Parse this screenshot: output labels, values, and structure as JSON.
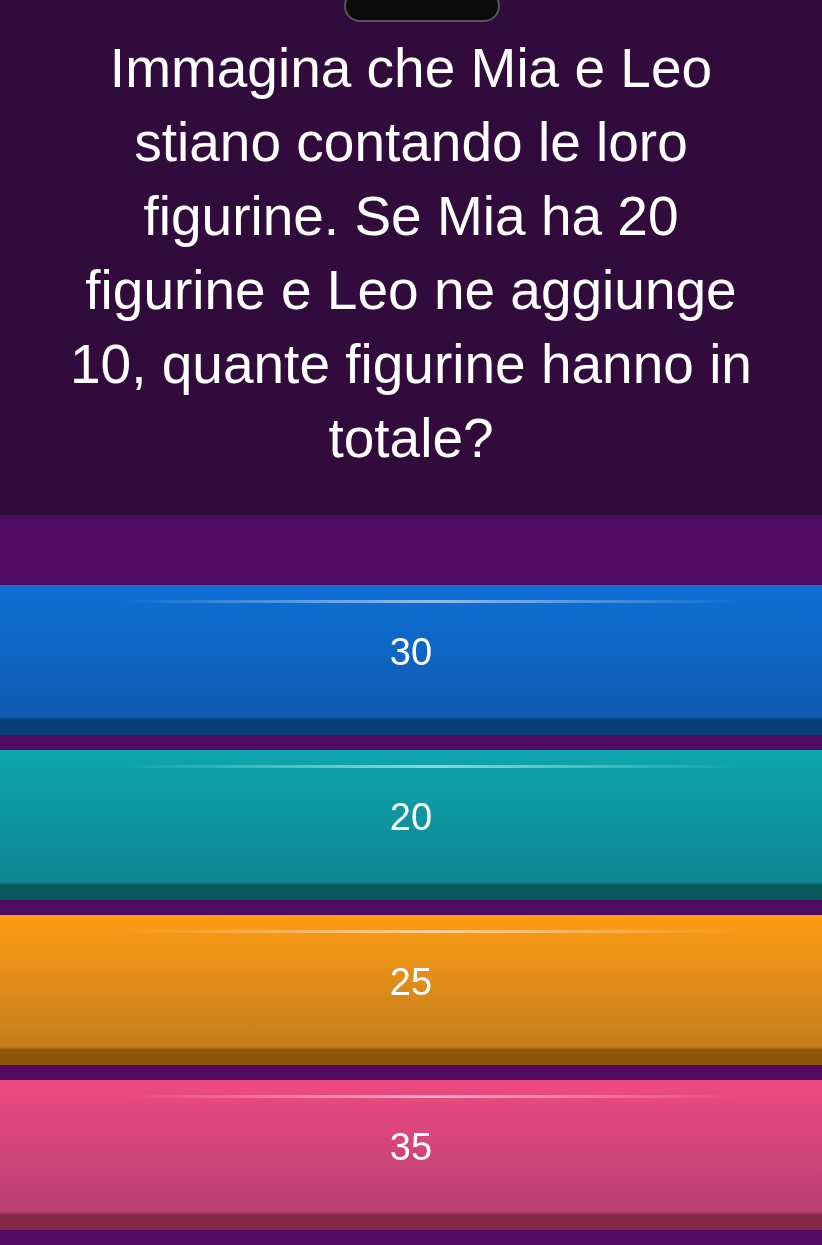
{
  "question": "Immagina che Mia e Leo stiano contando le loro figurine. Se Mia ha 20 figurine e Leo ne aggiunge 10, quante figurine hanno in totale?",
  "answers": [
    {
      "label": "30",
      "color": "#0e6fd6"
    },
    {
      "label": "20",
      "color": "#0ea6ad"
    },
    {
      "label": "25",
      "color": "#ff9c12"
    },
    {
      "label": "35",
      "color": "#ef4a82"
    }
  ]
}
